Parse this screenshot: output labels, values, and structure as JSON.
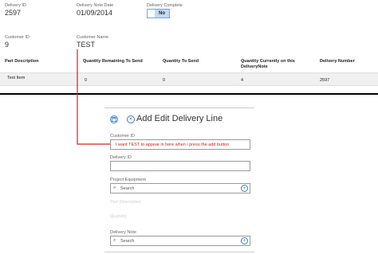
{
  "top": {
    "delivery_id_label": "Delivery ID",
    "delivery_id_value": "2597",
    "delivery_note_date_label": "Delivery Note Date",
    "delivery_note_date_value": "01/09/2014",
    "delivery_complete_label": "Delivery Complete",
    "delivery_complete_value": "No",
    "customer_id_label": "Customer ID",
    "customer_id_value": "9",
    "customer_name_label": "Customer Name",
    "customer_name_value": "TEST"
  },
  "table": {
    "headers": [
      "Part Description",
      "Quantity Remaining To Send",
      "Quantity To Send",
      "Quantity Currently on this DeliveryNote",
      "Delivery Number"
    ],
    "rows": [
      [
        "Test Item",
        "0",
        "0",
        "4",
        "2597"
      ]
    ]
  },
  "dialog": {
    "title": "Add Edit Delivery Line",
    "customer_id_label": "Customer ID",
    "customer_id_value": "I want TEST to appear in here when i press the add button",
    "delivery_id_label": "Delivery ID",
    "project_equipment_label": "Project Equipment",
    "project_equipment_placeholder": "Search",
    "part_description_label": "Part Description",
    "quantity_label": "Quantity",
    "delivery_note_label": "Delivery Note",
    "delivery_note_placeholder": "Search"
  },
  "colors": {
    "accent": "#3a7bd5",
    "annotation": "#d42020",
    "toggle_on": "#c4d8ee"
  }
}
